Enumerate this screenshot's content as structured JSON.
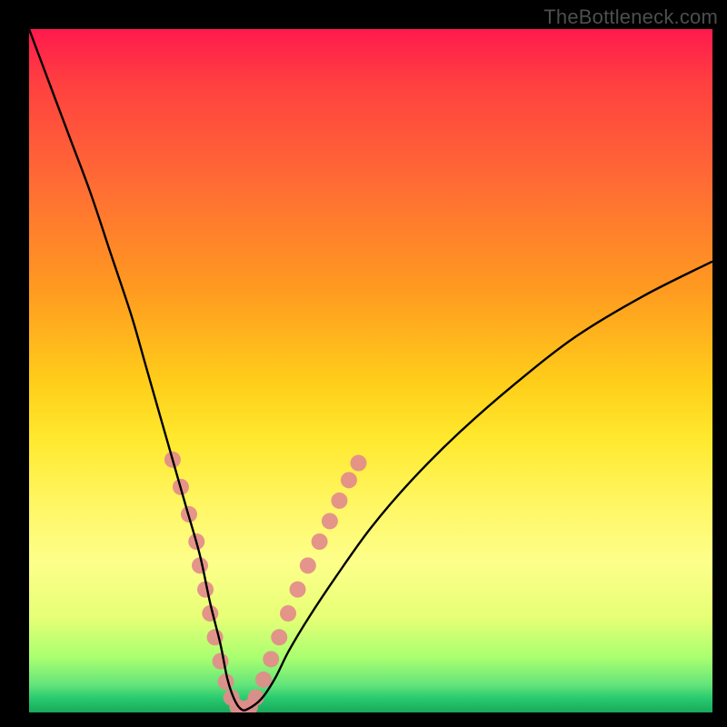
{
  "watermark": {
    "text": "TheBottleneck.com"
  },
  "chart_data": {
    "type": "line",
    "title": "",
    "xlabel": "",
    "ylabel": "",
    "xlim": [
      0,
      100
    ],
    "ylim": [
      0,
      100
    ],
    "grid": false,
    "legend": false,
    "background_gradient": {
      "stops": [
        {
          "pos": 0.0,
          "color": "#ff1a4d"
        },
        {
          "pos": 0.5,
          "color": "#ffcf1a"
        },
        {
          "pos": 0.8,
          "color": "#fdff8a"
        },
        {
          "pos": 1.0,
          "color": "#1aa85a"
        }
      ]
    },
    "series": [
      {
        "name": "bottleneck-curve",
        "color": "#000000",
        "x": [
          0,
          3,
          6,
          9,
          12,
          15,
          17,
          19,
          21,
          23,
          25,
          26.5,
          28,
          29,
          30,
          31,
          32,
          34,
          36,
          38,
          41,
          45,
          50,
          56,
          63,
          71,
          80,
          90,
          100
        ],
        "y": [
          100,
          92,
          84,
          76,
          67,
          58,
          51,
          44,
          37,
          30,
          23,
          16,
          10,
          5,
          2,
          0.5,
          0.5,
          2,
          5,
          9,
          14,
          20,
          27,
          34,
          41,
          48,
          55,
          61,
          66
        ]
      }
    ],
    "markers": {
      "name": "highlight-dots",
      "color": "#e38b8b",
      "radius": 9,
      "points": [
        {
          "x": 21.0,
          "y": 37
        },
        {
          "x": 22.2,
          "y": 33
        },
        {
          "x": 23.4,
          "y": 29
        },
        {
          "x": 24.5,
          "y": 25
        },
        {
          "x": 25.0,
          "y": 21.5
        },
        {
          "x": 25.8,
          "y": 18
        },
        {
          "x": 26.5,
          "y": 14.5
        },
        {
          "x": 27.2,
          "y": 11
        },
        {
          "x": 28.0,
          "y": 7.5
        },
        {
          "x": 28.8,
          "y": 4.5
        },
        {
          "x": 29.6,
          "y": 2.2
        },
        {
          "x": 30.5,
          "y": 0.8
        },
        {
          "x": 31.4,
          "y": 0.5
        },
        {
          "x": 32.3,
          "y": 0.8
        },
        {
          "x": 33.2,
          "y": 2.2
        },
        {
          "x": 34.3,
          "y": 4.8
        },
        {
          "x": 35.4,
          "y": 7.8
        },
        {
          "x": 36.6,
          "y": 11
        },
        {
          "x": 37.9,
          "y": 14.5
        },
        {
          "x": 39.3,
          "y": 18
        },
        {
          "x": 40.8,
          "y": 21.5
        },
        {
          "x": 42.5,
          "y": 25
        },
        {
          "x": 44.0,
          "y": 28
        },
        {
          "x": 45.4,
          "y": 31
        },
        {
          "x": 46.8,
          "y": 34
        },
        {
          "x": 48.2,
          "y": 36.5
        }
      ]
    }
  }
}
